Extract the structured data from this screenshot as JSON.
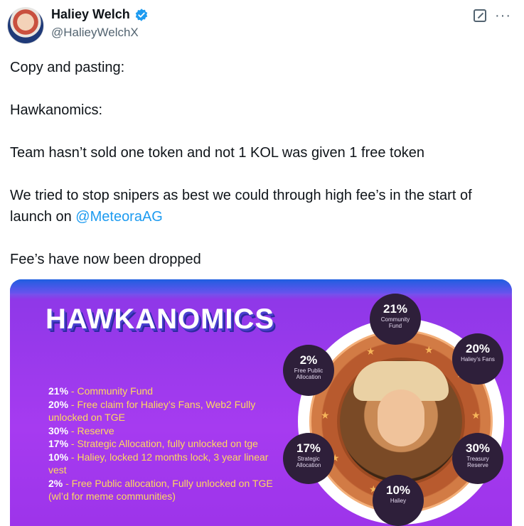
{
  "author": {
    "display_name": "Haliey Welch",
    "handle": "@HalieyWelchX",
    "verified": true,
    "avatar": "profile-photo"
  },
  "icons": {
    "grok": "grok-icon",
    "more": "more-icon"
  },
  "tweet": {
    "paragraphs": [
      "Copy and pasting:",
      "Hawkanomics:",
      "Team hasn’t sold one token and not 1 KOL was given 1 free token",
      "Fee’s have now been dropped"
    ],
    "launch_paragraph_prefix": "We tried to stop snipers as best we could through high fee’s in the start of launch on ",
    "mention": "@MeteoraAG"
  },
  "media": {
    "title": "HAWKANOMICS",
    "allocations": [
      {
        "pct": "21%",
        "text": " - Community Fund"
      },
      {
        "pct": "20%",
        "text": " - Free claim for Haliey’s Fans, Web2 Fully unlocked on TGE"
      },
      {
        "pct": "30%",
        "text": " - Reserve"
      },
      {
        "pct": "17%",
        "text": " - Strategic Allocation, fully unlocked on tge"
      },
      {
        "pct": "10%",
        "text": " - Haliey, locked 12 months lock, 3 year linear vest"
      },
      {
        "pct": "2%",
        "text": " - Free Public allocation, Fully unlocked on TGE (wl’d for meme communities)"
      }
    ],
    "badges": [
      {
        "pct": "21%",
        "label": "Community Fund"
      },
      {
        "pct": "20%",
        "label": "Haliey’s Fans"
      },
      {
        "pct": "30%",
        "label": "Treasury Reserve"
      },
      {
        "pct": "10%",
        "label": "Haliey"
      },
      {
        "pct": "17%",
        "label": "Strategic Allocation"
      },
      {
        "pct": "2%",
        "label": "Free Public Allocation"
      }
    ],
    "colors": {
      "background": "#a63bf0",
      "title": "#ffffff",
      "list_text": "#ffd95e",
      "badge": "#2e1f3a",
      "coin": "#b85a2e"
    }
  }
}
